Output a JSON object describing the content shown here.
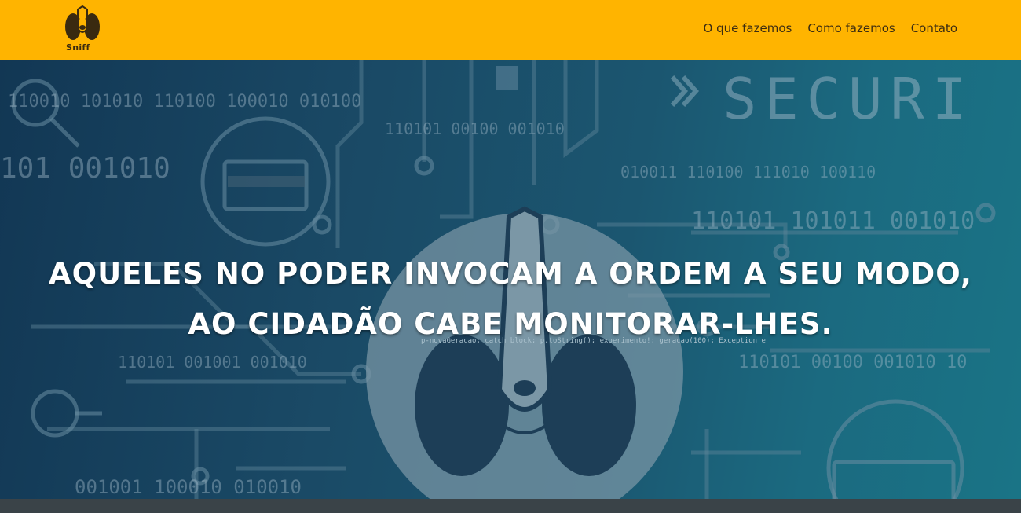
{
  "brand": {
    "name": "Sniff"
  },
  "nav": {
    "items": [
      {
        "label": "O que fazemos"
      },
      {
        "label": "Como fazemos"
      },
      {
        "label": "Contato"
      }
    ]
  },
  "hero": {
    "headline_line1": "AQUELES NO PODER INVOCAM A ORDEM A SEU MODO,",
    "headline_line2": "AO CIDADÃO CABE MONITORAR-LHES.",
    "background_words": {
      "secure": "SECURI",
      "bin1": "110010 101010 110100 100010 010100",
      "bin2": "110101 00100 001010",
      "bin3": "101 001010",
      "bin4": "010011 110100 111010 100110",
      "bin5": "110101 101011 001010",
      "bin6": "110101 001001 001010",
      "bin7": "110101 00100 001010 10",
      "bin8": "001001 100010 010010",
      "code": "p-novaGeracao; catch block; p.toString(); experimento!; geracao(100); Exception e"
    }
  },
  "colors": {
    "navbar": "#ffb400",
    "nav_text": "#3b2c12",
    "hero_text": "#ffffff"
  }
}
